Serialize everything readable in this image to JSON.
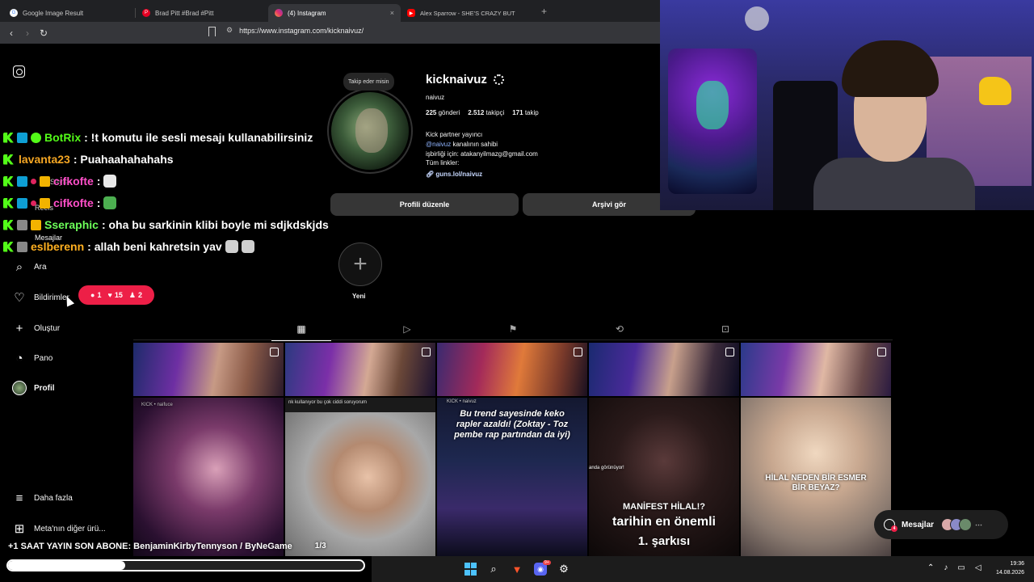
{
  "browser": {
    "tabs": [
      {
        "title": "Google Image Result",
        "icon": "google-icon",
        "color": "#ffffff"
      },
      {
        "title": "Brad Pitt #Brad #Pitt",
        "icon": "pinterest-icon",
        "color": "#e60023"
      },
      {
        "title": "(4) Instagram",
        "icon": "instagram-icon",
        "color": "#e1306c"
      },
      {
        "title": "Alex Sparrow - SHE'S CRAZY BUT",
        "icon": "youtube-icon",
        "color": "#ff0000"
      }
    ],
    "close_glyph": "×",
    "new_tab_glyph": "+",
    "url": "https://www.instagram.com/kicknaivuz/"
  },
  "sidebar": {
    "items": [
      {
        "label": "Ara",
        "icon": "search-icon",
        "glyph": "⌕"
      },
      {
        "label": "Bildirimler",
        "icon": "heart-icon",
        "glyph": "♡"
      },
      {
        "label": "Oluştur",
        "icon": "plus-icon",
        "glyph": "+"
      },
      {
        "label": "Pano",
        "icon": "dashboard-icon",
        "glyph": "◔"
      },
      {
        "label": "Profil",
        "icon": "profile-avatar-icon",
        "glyph": ""
      },
      {
        "label": "Daha fazla",
        "icon": "menu-icon",
        "glyph": "≡"
      },
      {
        "label": "Meta'nın diğer ürü...",
        "icon": "meta-apps-icon",
        "glyph": "⊞"
      }
    ],
    "hidden_items": [
      "Sayfa",
      "Reels",
      "Mesajlar"
    ],
    "notif_pill": {
      "comments": "1",
      "likes": "15",
      "follows": "2"
    }
  },
  "profile": {
    "note_bubble": "Takip eder misin",
    "username": "kicknaivuz",
    "full_name": "naivuz",
    "posts_count": "225",
    "posts_label": "gönderi",
    "followers_count": "2.512",
    "followers_label": "takipçi",
    "following_count": "171",
    "following_label": "takip",
    "bio_line1": "Kick partner yayıncı",
    "bio_mention": "@naivuz",
    "bio_line2_rest": "kanalının sahibi",
    "bio_line3": "işbirliği için: atakanyilmazg@gmail.com",
    "bio_line4": "Tüm linkler:",
    "bio_link": "guns.lol/naivuz",
    "edit_button": "Profili düzenle",
    "archive_button": "Arşivi gör",
    "new_highlight_label": "Yeni"
  },
  "profile_tabs": [
    "grid-icon",
    "reels-icon",
    "saved-icon",
    "reposts-icon",
    "tagged-icon"
  ],
  "posts": {
    "b1_caption": "KICK • naifuce",
    "b2_caption": "nk kullanıyor bu çok ciddi soruyorum",
    "b3_header": "KICK • naivuz",
    "b3_caption": "Bu trend sayesinde keko rapler azaldı! (Zoktay - Toz pembe rap partından da iyi)",
    "b4_caption_small": "anda görünüyor!",
    "b4_caption_big1": "MANİFEST HİLAL!?",
    "b4_caption_big2": "tarihin en önemli",
    "b4_caption_big3": "1. şarkısı",
    "b5_caption": "HİLAL NEDEN BİR ESMER BİR BEYAZ?"
  },
  "messages_box": {
    "label": "Mesajlar",
    "badge": "4"
  },
  "chat": [
    {
      "user": "BotRix",
      "message": ": !t komutu ile sesli mesajı kullanabilirsiniz"
    },
    {
      "user": "lavanta23",
      "message": ": Puahaahahahahs"
    },
    {
      "user": "cifkofte",
      "message": ":"
    },
    {
      "user": "cifkofte",
      "message": ":"
    },
    {
      "user": "Sseraphic",
      "message": ": oha bu sarkinin klibi boyle mi sdjkdskjds"
    },
    {
      "user": "eslberenn",
      "message": ": allah beni kahretsin yav"
    }
  ],
  "stream": {
    "ticker": "+1 SAAT YAYIN SON ABONE: BenjaminKirbyTennyson / ByNeGame",
    "pages": "1/3",
    "progress": 0.33
  },
  "taskbar": {
    "time": "19:36",
    "date": "14.08.2026",
    "discord_badge": "9+"
  }
}
